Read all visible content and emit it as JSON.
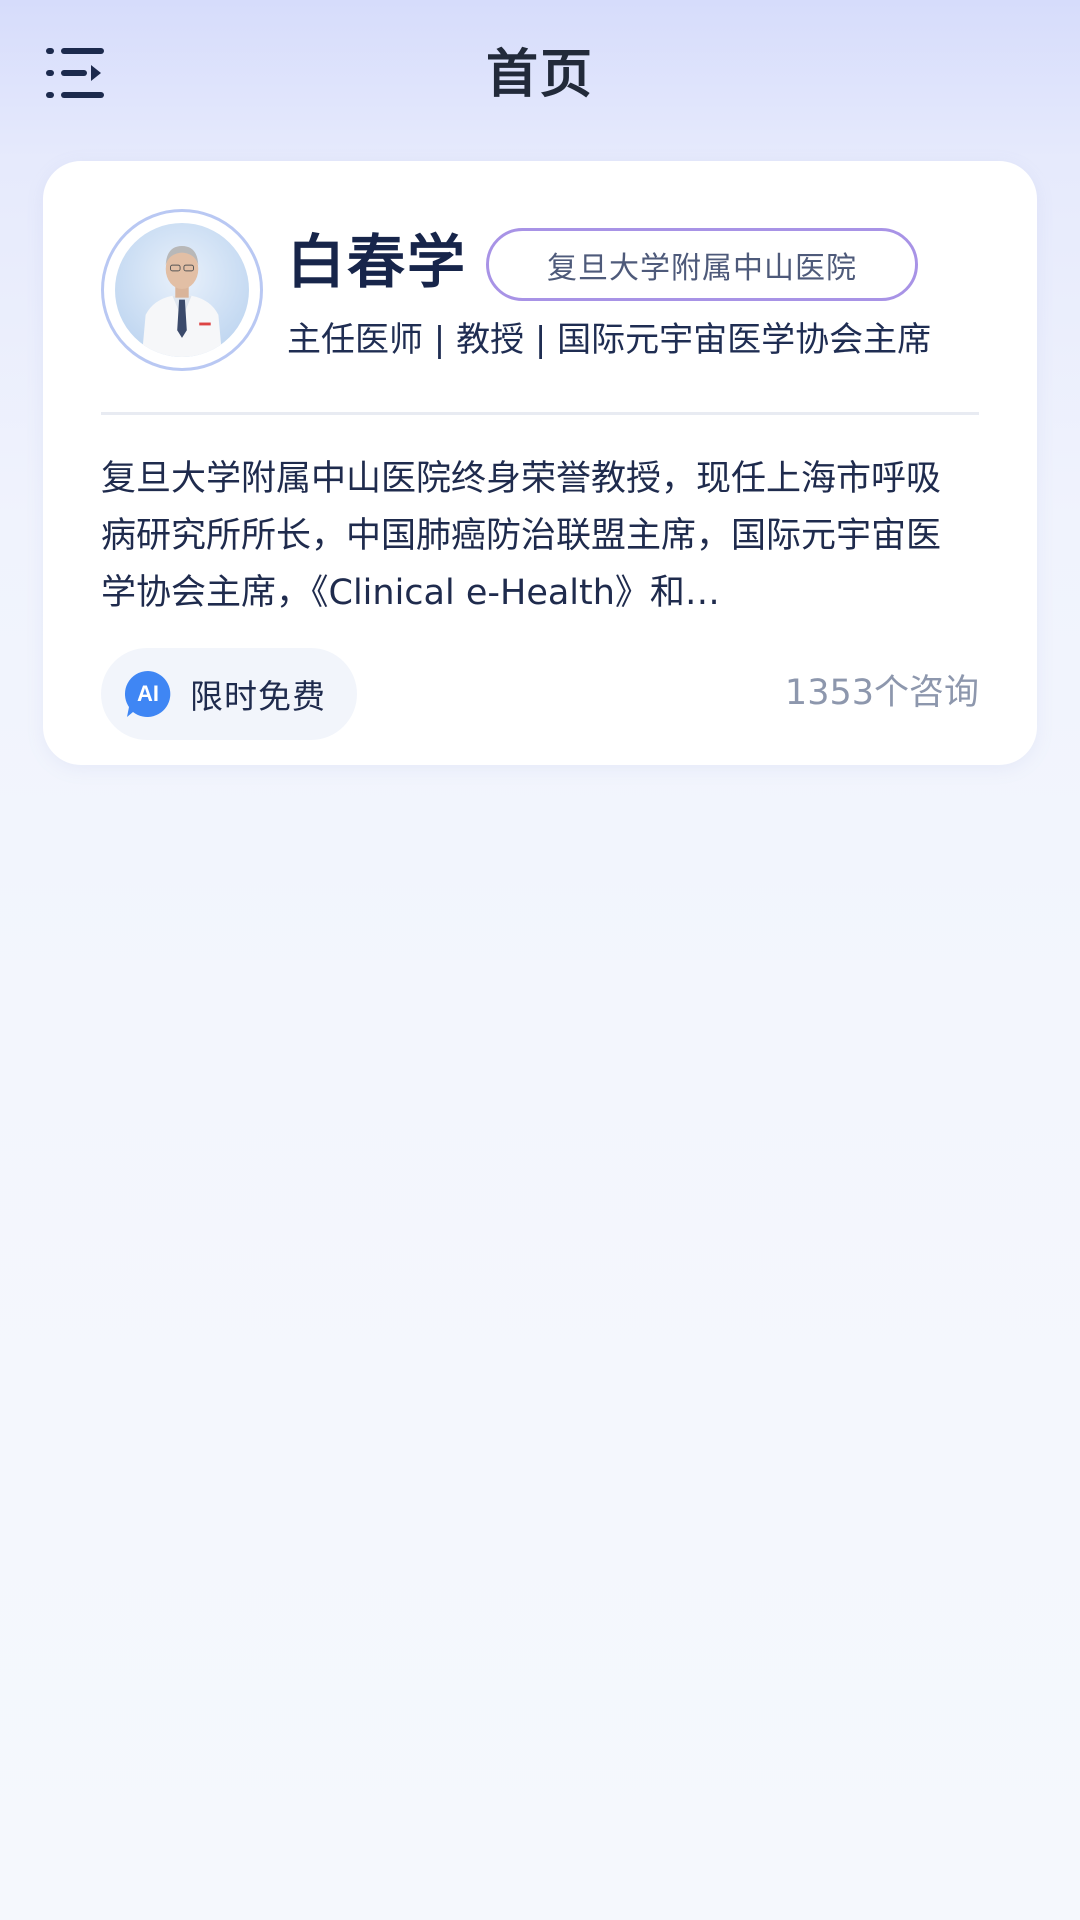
{
  "header": {
    "title": "首页",
    "menu_icon": "menu-unfold-icon"
  },
  "doctor_card": {
    "name": "白春学",
    "hospital": "复旦大学附属中山医院",
    "titles": "主任医师 | 教授 | 国际元宇宙医学协会主席",
    "bio": "复旦大学附属中山医院终身荣誉教授，现任上海市呼吸病研究所所长，中国肺癌防治联盟主席，国际元宇宙医学协会主席，《Clinical e-Health》和…",
    "ai_badge": {
      "icon_text": "AI",
      "label": "限时免费"
    },
    "consult_count": "1353个咨询"
  },
  "colors": {
    "title": "#222a3a",
    "name": "#17254a",
    "tag_border": "#a893e6",
    "ai_blue": "#3f86f4",
    "muted": "#8d97ad",
    "card_bg": "#ffffff"
  }
}
